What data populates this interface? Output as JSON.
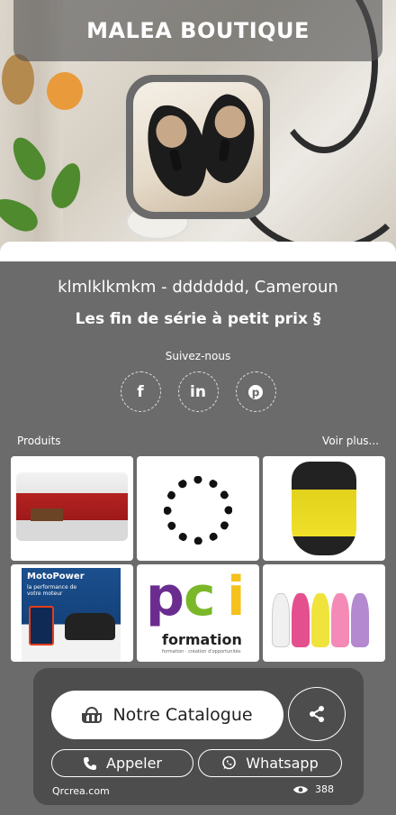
{
  "header": {
    "title": "MALEA BOUTIQUE"
  },
  "profile": {
    "location": "klmlklkmkm - ddddddd, Cameroun",
    "slogan": "Les fin de série à petit prix §"
  },
  "social": {
    "label": "Suivez-nous",
    "items": [
      {
        "name": "facebook",
        "glyph": "f"
      },
      {
        "name": "linkedin",
        "glyph": "in"
      },
      {
        "name": "pinterest",
        "glyph": "℗"
      }
    ]
  },
  "products": {
    "label": "Produits",
    "more": "Voir plus...",
    "items": [
      {
        "name": "sofa-set"
      },
      {
        "name": "black-bead-bracelet"
      },
      {
        "name": "yellow-bead-necklace"
      },
      {
        "name": "motopower-oil",
        "title": "MotoPower",
        "subtitle": "la performance de votre moteur"
      },
      {
        "name": "pci-formation",
        "letters": [
          "p",
          "c",
          "i"
        ],
        "word": "formation",
        "tagline": "formation · création d'opportunités"
      },
      {
        "name": "dresses"
      }
    ]
  },
  "actions": {
    "catalog": "Notre Catalogue",
    "call": "Appeler",
    "whatsapp": "Whatsapp"
  },
  "footer": {
    "brand": "Qrcrea.com",
    "views": "388"
  },
  "colors": {
    "background": "#6b6b6b",
    "panel": "#4b4b4b",
    "accent_white": "#ffffff"
  }
}
